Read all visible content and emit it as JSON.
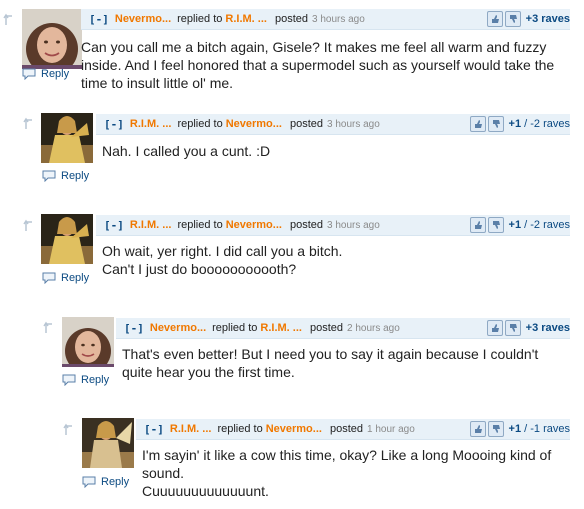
{
  "comments": [
    {
      "toggle": "[-]",
      "author": "Nevermo...",
      "replied_to_text": "replied to",
      "target": "R.I.M. ...",
      "posted_text": "posted",
      "time": "3 hours ago",
      "raves": "+3 raves",
      "body": "Can you call me a bitch again, Gisele? It makes me feel all warm and fuzzy inside. And I feel honored that a supermodel such as yourself would take the time to insult little ol' me.",
      "reply_label": "Reply"
    },
    {
      "toggle": "[-]",
      "author": "R.I.M. ...",
      "replied_to_text": "replied to",
      "target": "Nevermo...",
      "posted_text": "posted",
      "time": "3 hours ago",
      "raves_pos": "+1",
      "raves_neg": "/ -2 raves",
      "body": "Nah. I called you a cunt. :D",
      "reply_label": "Reply"
    },
    {
      "toggle": "[-]",
      "author": "R.I.M. ...",
      "replied_to_text": "replied to",
      "target": "Nevermo...",
      "posted_text": "posted",
      "time": "3 hours ago",
      "raves_pos": "+1",
      "raves_neg": "/ -2 raves",
      "body_line1": "Oh wait, yer right. I did call you a bitch.",
      "body_line2": "Can't I just do booooooooooth?",
      "reply_label": "Reply"
    },
    {
      "toggle": "[-]",
      "author": "Nevermo...",
      "replied_to_text": "replied to",
      "target": "R.I.M. ...",
      "posted_text": "posted",
      "time": "2 hours ago",
      "raves": "+3 raves",
      "body": "That's even better! But I need you to say it again because I couldn't quite hear you the first time.",
      "reply_label": "Reply"
    },
    {
      "toggle": "[-]",
      "author": "R.I.M. ...",
      "replied_to_text": "replied to",
      "target": "Nevermo...",
      "posted_text": "posted",
      "time": "1 hour ago",
      "raves_pos": "+1",
      "raves_neg": "/ -1 raves",
      "body_line1": "I'm sayin' it like a cow this time, okay? Like a long Moooing kind of sound.",
      "body_line2": "Cuuuuuuuuuuuuunt.",
      "reply_label": "Reply"
    }
  ],
  "colors": {
    "author": "#f07800",
    "link": "#0b4a82",
    "header_bg": "#e8f1f8",
    "time": "#8a8a8a"
  },
  "icons": {
    "thread": "reply-arrow-icon",
    "thumbs_up": "thumbs-up-icon",
    "thumbs_down": "thumbs-down-icon",
    "reply": "speech-bubble-icon"
  }
}
